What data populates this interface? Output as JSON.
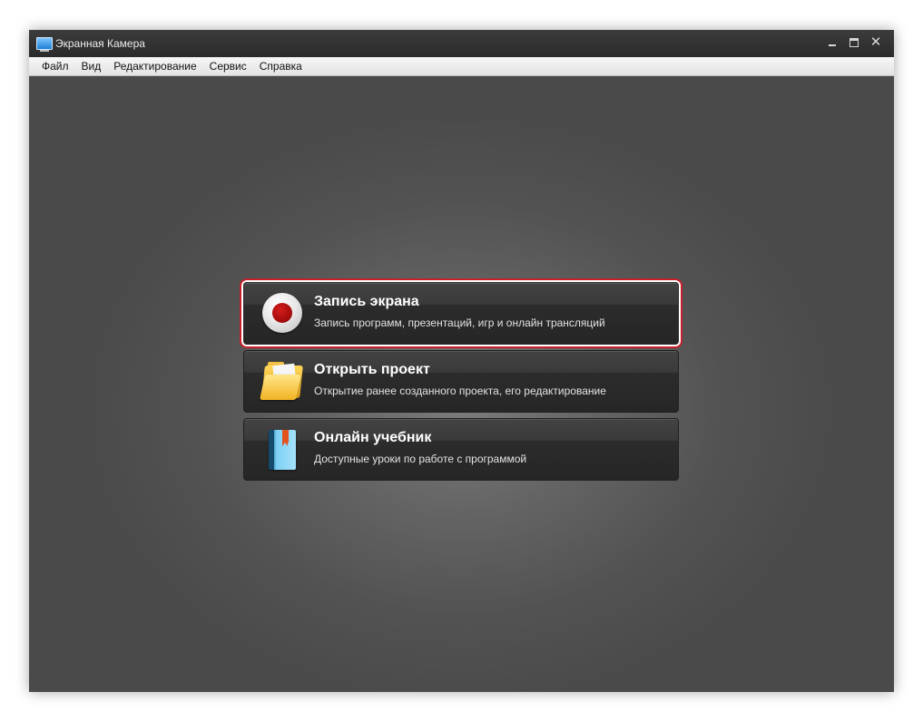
{
  "window": {
    "title": "Экранная Камера",
    "controls": {
      "minimize": "minimize",
      "maximize": "maximize",
      "close": "✕"
    }
  },
  "menu": {
    "items": [
      {
        "label": "Файл"
      },
      {
        "label": "Вид"
      },
      {
        "label": "Редактирование"
      },
      {
        "label": "Сервис"
      },
      {
        "label": "Справка"
      }
    ]
  },
  "actions": {
    "record": {
      "title": "Запись экрана",
      "description": "Запись программ, презентаций, игр и онлайн трансляций",
      "icon": "record-icon",
      "selected": true,
      "highlight_color": "#c8202a"
    },
    "open": {
      "title": "Открыть проект",
      "description": "Открытие ранее созданного проекта, его редактирование",
      "icon": "folder-icon"
    },
    "tutorial": {
      "title": "Онлайн учебник",
      "description": "Доступные уроки по работе с программой",
      "icon": "book-icon"
    }
  }
}
